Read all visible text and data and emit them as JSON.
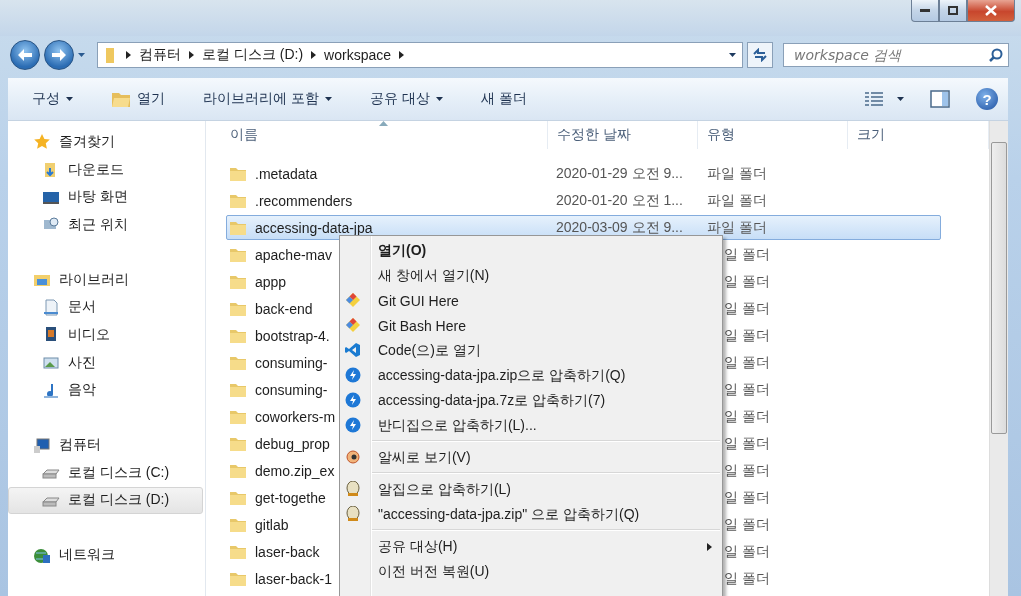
{
  "address": {
    "crumbs": [
      "컴퓨터",
      "로컬 디스크 (D:)",
      "workspace"
    ]
  },
  "search": {
    "placeholder": "workspace 검색"
  },
  "toolbar": {
    "items": [
      {
        "label": "구성",
        "kind": "plain",
        "dropdown": true
      },
      {
        "label": "열기",
        "kind": "open",
        "dropdown": false
      },
      {
        "label": "라이브러리에 포함",
        "kind": "plain",
        "dropdown": true
      },
      {
        "label": "공유 대상",
        "kind": "plain",
        "dropdown": true
      },
      {
        "label": "새 폴더",
        "kind": "plain",
        "dropdown": false
      }
    ],
    "help": "?"
  },
  "sidebar": {
    "groups": [
      {
        "label": "즐겨찾기",
        "kind": "star",
        "selected": false,
        "children": [
          {
            "label": "다운로드",
            "kind": "download",
            "selected": false
          },
          {
            "label": "바탕 화면",
            "kind": "desktop",
            "selected": false
          },
          {
            "label": "최근 위치",
            "kind": "recent",
            "selected": false
          }
        ]
      },
      {
        "label": "라이브러리",
        "kind": "library",
        "selected": false,
        "children": [
          {
            "label": "문서",
            "kind": "document",
            "selected": false
          },
          {
            "label": "비디오",
            "kind": "video",
            "selected": false
          },
          {
            "label": "사진",
            "kind": "picture",
            "selected": false
          },
          {
            "label": "음악",
            "kind": "music",
            "selected": false
          }
        ]
      },
      {
        "label": "컴퓨터",
        "kind": "computer",
        "selected": false,
        "children": [
          {
            "label": "로컬 디스크 (C:)",
            "kind": "drive",
            "selected": false
          },
          {
            "label": "로컬 디스크 (D:)",
            "kind": "drive",
            "selected": true
          }
        ]
      },
      {
        "label": "네트워크",
        "kind": "network",
        "selected": false
      }
    ]
  },
  "table": {
    "columns": [
      "이름",
      "수정한 날짜",
      "유형",
      "크기"
    ],
    "rows": [
      {
        "name": ".metadata",
        "date": "2020-01-29 오전 9...",
        "type": "파일 폴더",
        "selected": false
      },
      {
        "name": ".recommenders",
        "date": "2020-01-20 오전 1...",
        "type": "파일 폴더",
        "selected": false
      },
      {
        "name": "accessing-data-jpa",
        "date": "2020-03-09 오전 9...",
        "type": "파일 폴더",
        "selected": true
      },
      {
        "name": "apache-mav",
        "type": "일 폴더",
        "selected": false
      },
      {
        "name": "appp",
        "type": "일 폴더",
        "selected": false
      },
      {
        "name": "back-end",
        "type": "일 폴더",
        "selected": false
      },
      {
        "name": "bootstrap-4.",
        "type": "일 폴더",
        "selected": false
      },
      {
        "name": "consuming-",
        "type": "일 폴더",
        "selected": false
      },
      {
        "name": "consuming-",
        "type": "일 폴더",
        "selected": false
      },
      {
        "name": "coworkers-m",
        "type": "일 폴더",
        "selected": false
      },
      {
        "name": "debug_prop",
        "type": "일 폴더",
        "selected": false
      },
      {
        "name": "demo.zip_ex",
        "type": "일 폴더",
        "selected": false
      },
      {
        "name": "get-togethe",
        "type": "일 폴더",
        "selected": false
      },
      {
        "name": "gitlab",
        "type": "일 폴더",
        "selected": false
      },
      {
        "name": "laser-back",
        "type": "일 폴더",
        "selected": false
      },
      {
        "name": "laser-back-1",
        "type": "일 폴더",
        "selected": false
      }
    ]
  },
  "context_menu": {
    "items": [
      {
        "kind": "plain",
        "label": "열기(O)",
        "default": true,
        "submenu": false
      },
      {
        "kind": "plain",
        "label": "새 창에서 열기(N)",
        "default": false,
        "submenu": false
      },
      {
        "kind": "git",
        "label": "Git GUI Here",
        "default": false,
        "submenu": false
      },
      {
        "kind": "git",
        "label": "Git Bash Here",
        "default": false,
        "submenu": false
      },
      {
        "kind": "vscode",
        "label": "Code(으)로 열기",
        "default": false,
        "submenu": false
      },
      {
        "kind": "bandizip",
        "label": "accessing-data-jpa.zip으로 압축하기(Q)",
        "default": false,
        "submenu": false
      },
      {
        "kind": "bandizip",
        "label": "accessing-data-jpa.7z로 압축하기(7)",
        "default": false,
        "submenu": false
      },
      {
        "kind": "bandizip",
        "label": "반디집으로 압축하기(L)...",
        "default": false,
        "submenu": false
      },
      {
        "kind": "separator"
      },
      {
        "kind": "alsee",
        "label": "알씨로 보기(V)",
        "default": false,
        "submenu": false
      },
      {
        "kind": "separator"
      },
      {
        "kind": "alzip",
        "label": "알집으로 압축하기(L)",
        "default": false,
        "submenu": false
      },
      {
        "kind": "alzip",
        "label": "\"accessing-data-jpa.zip\" 으로 압축하기(Q)",
        "default": false,
        "submenu": false
      },
      {
        "kind": "separator"
      },
      {
        "kind": "plain",
        "label": "공유 대상(H)",
        "default": false,
        "submenu": true
      },
      {
        "kind": "plain",
        "label": "이전 버전 복원(U)",
        "default": false,
        "submenu": false
      }
    ]
  }
}
